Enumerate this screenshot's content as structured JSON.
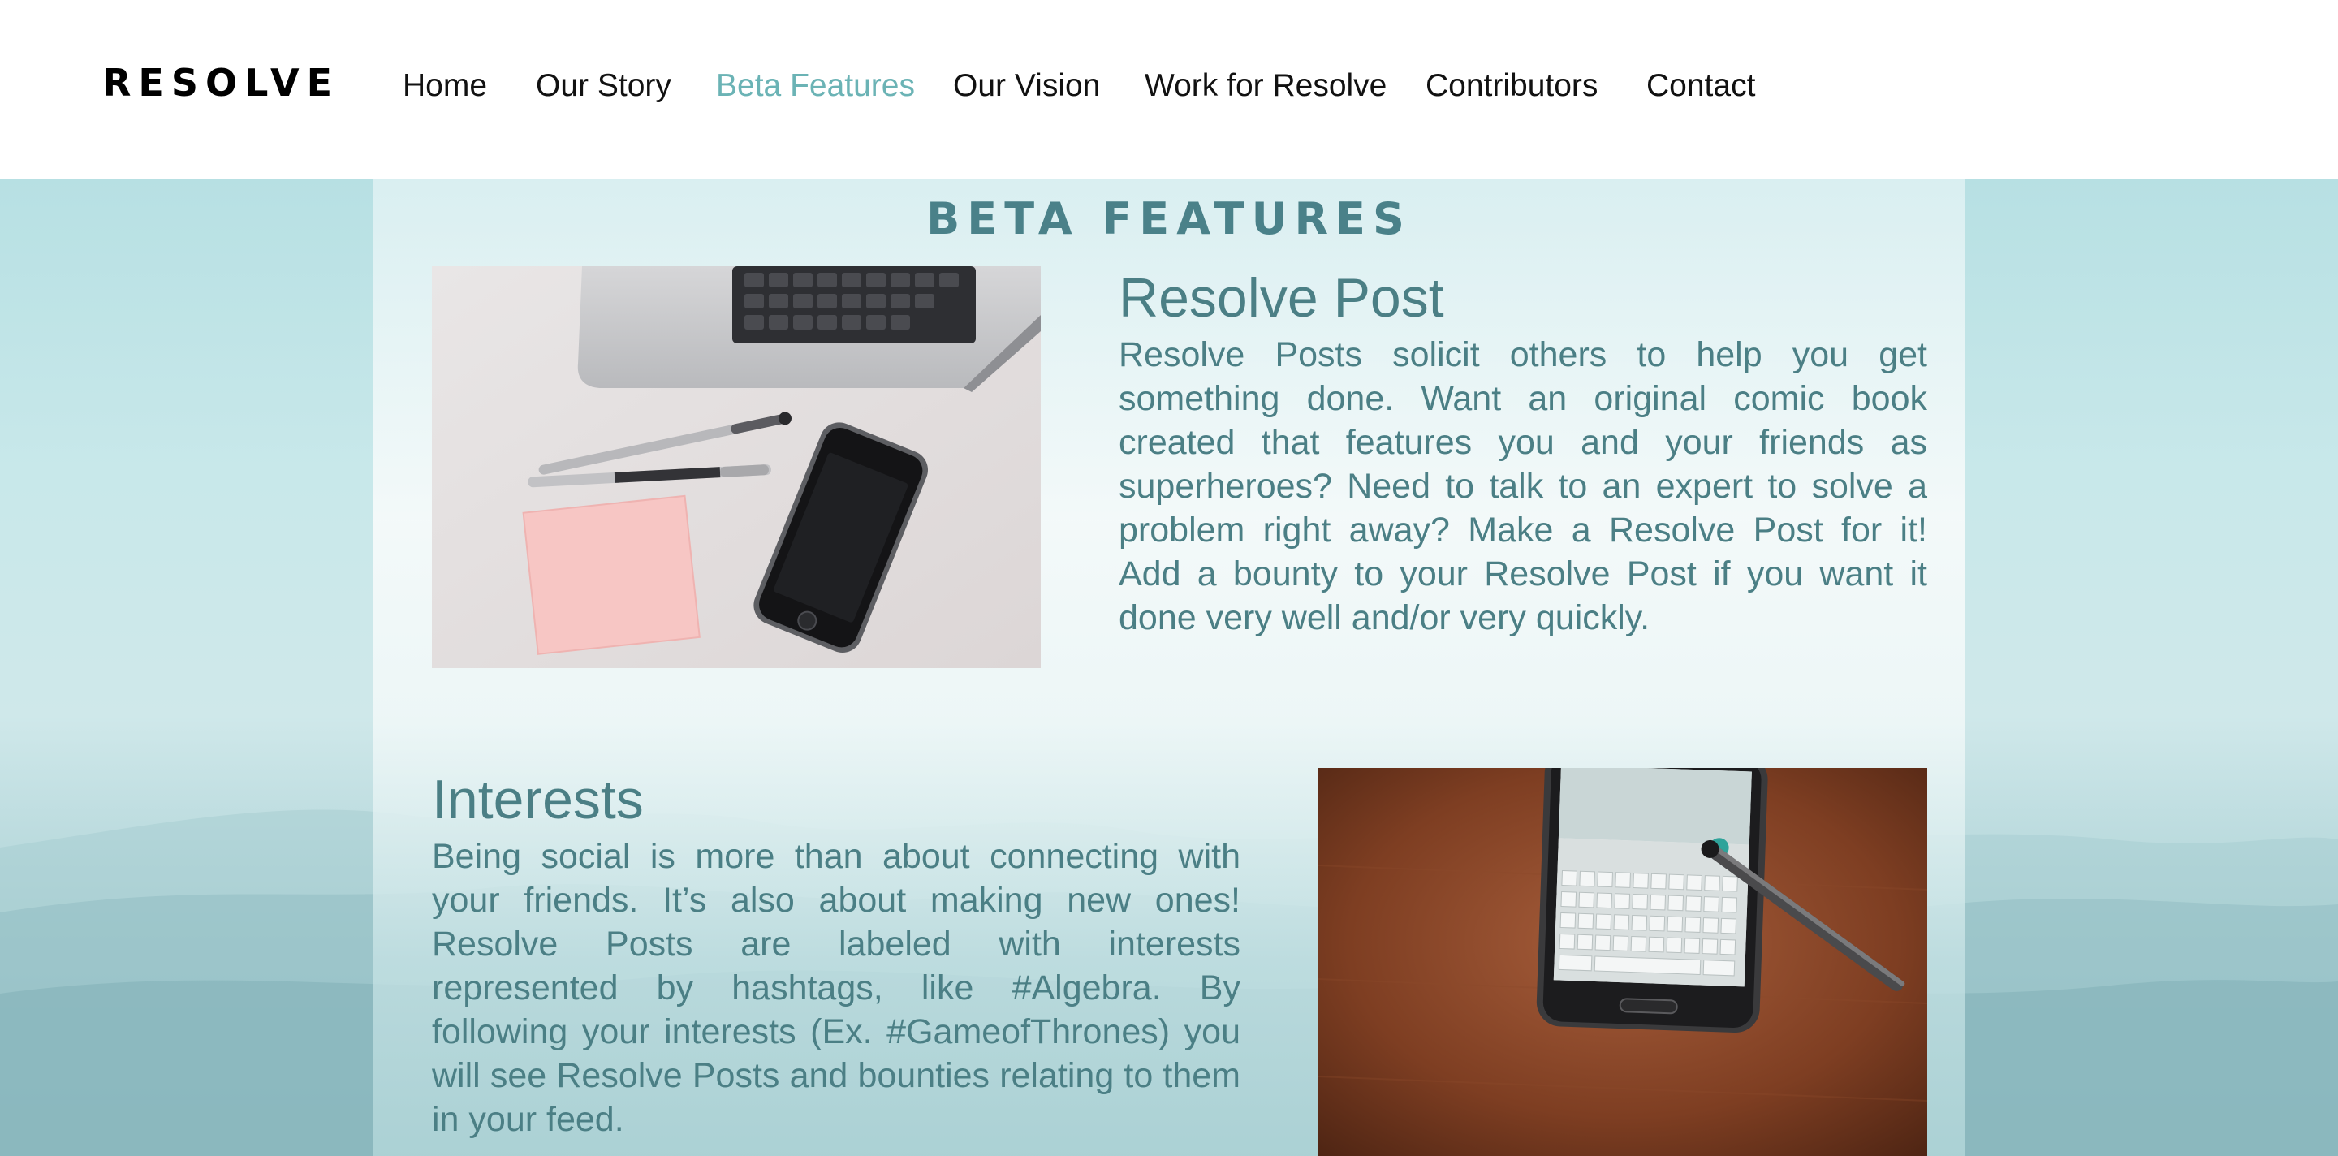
{
  "header": {
    "logo": "RESOLVE",
    "nav": [
      {
        "label": "Home"
      },
      {
        "label": "Our Story"
      },
      {
        "label": "Beta Features",
        "active": true
      },
      {
        "label": "Our Vision"
      },
      {
        "label": "Work for Resolve"
      },
      {
        "label": "Contributors"
      },
      {
        "label": "Contact"
      }
    ],
    "active_color": "#6bb3b5"
  },
  "page": {
    "section_title": "BETA FEATURES"
  },
  "features": [
    {
      "title": "Resolve Post",
      "body": "Resolve Posts solicit others to help you get something done. Want an original comic book created that features you and your friends as superheroes? Need to talk to an expert to solve a problem right away? Make a Resolve Post for it! Add a bounty to your Resolve Post if you want it done very well and/or very quickly."
    },
    {
      "title": "Interests",
      "body": "Being social is more than about connecting with your friends. It’s also about making new ones! Resolve Posts are labeled with interests represented by hashtags, like #Algebra. By following your interests (Ex. #GameofThrones) you will see Resolve Posts and bounties relating to them in your feed."
    }
  ],
  "colors": {
    "accent": "#4b7f85",
    "background_sky": "#b7e0e3"
  }
}
